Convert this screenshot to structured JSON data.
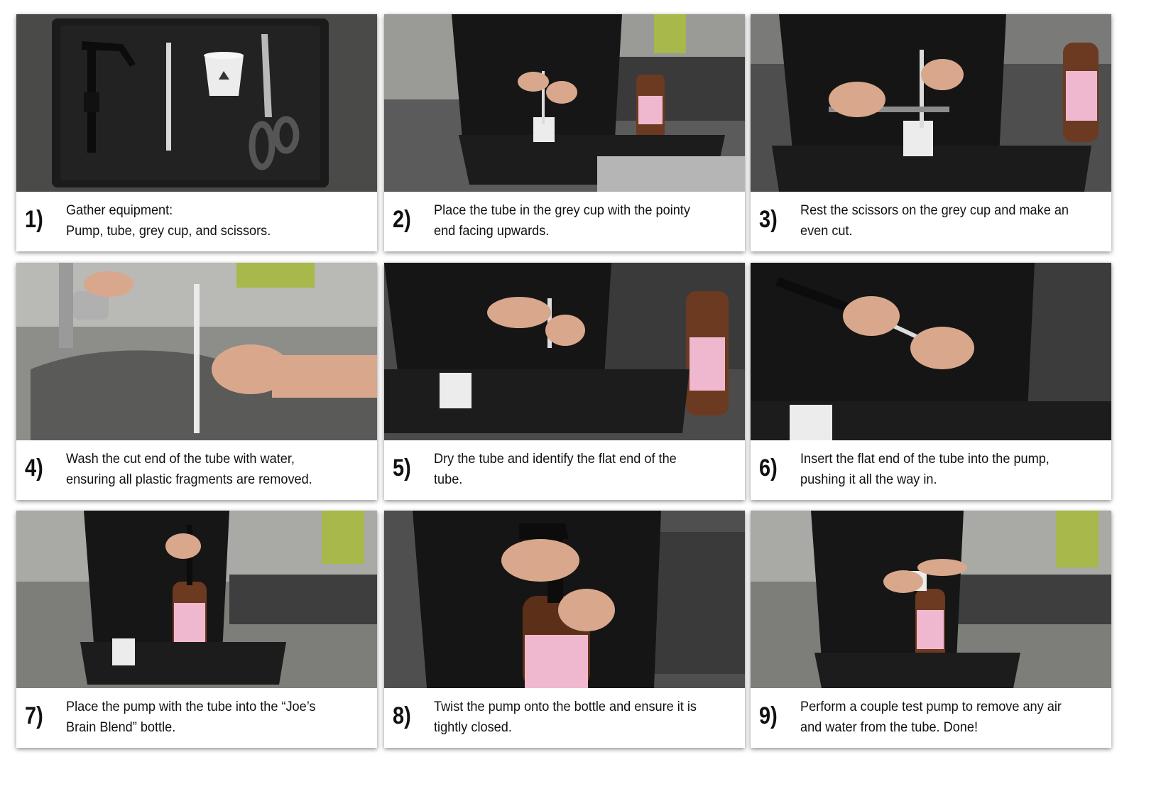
{
  "steps": [
    {
      "number": "1)",
      "text": "Gather equipment:\nPump, tube, grey cup, and scissors.",
      "photo": "equipment-photo"
    },
    {
      "number": "2)",
      "text": "Place the tube in the grey cup with the pointy\nend facing upwards.",
      "photo": "tube-in-cup-photo"
    },
    {
      "number": "3)",
      "text": "Rest the scissors on the grey cup and make an\neven cut.",
      "photo": "cutting-tube-photo"
    },
    {
      "number": "4)",
      "text": "Wash the cut end of the tube with water,\nensuring all plastic fragments are removed.",
      "photo": "washing-tube-photo"
    },
    {
      "number": "5)",
      "text": "Dry the tube and identify the flat end of the\ntube.",
      "photo": "drying-tube-photo"
    },
    {
      "number": "6)",
      "text": "Insert the flat end of the tube into the pump,\npushing it all the way in.",
      "photo": "inserting-tube-photo"
    },
    {
      "number": "7)",
      "text": "Place the pump with the tube into the “Joe’s\nBrain Blend” bottle.",
      "photo": "placing-pump-photo"
    },
    {
      "number": "8)",
      "text": "Twist the pump onto the bottle and ensure it is\ntightly closed.",
      "photo": "twisting-pump-photo"
    },
    {
      "number": "9)",
      "text": "Perform a couple test pump to remove any air\nand water from the tube. Done!",
      "photo": "test-pump-photo"
    }
  ],
  "colors": {
    "caption_bg": "#ffffff",
    "text": "#111111",
    "bottle_label": "#f0b8cf",
    "shirt": "#161616",
    "counter": "#6c6c6c"
  }
}
